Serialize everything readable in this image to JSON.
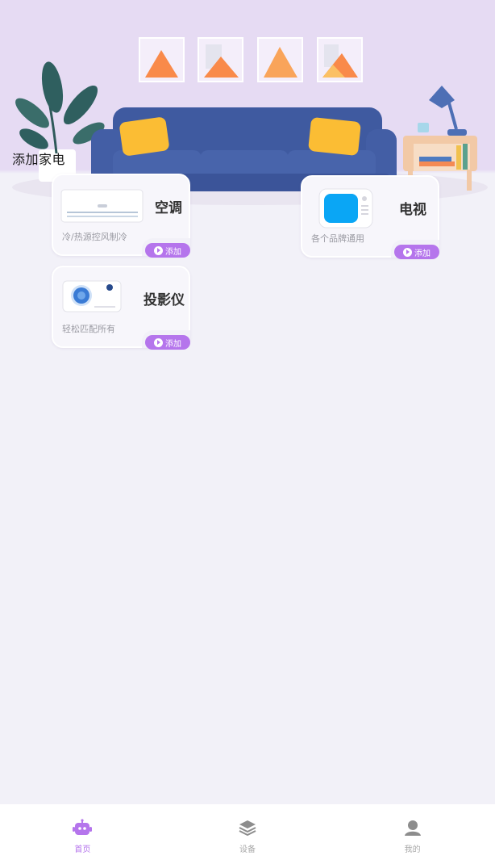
{
  "section_title": "添加家电",
  "devices": [
    {
      "name": "空调",
      "desc": "冷/热源控风制冷",
      "add_label": "添加",
      "icon": "air-conditioner-icon"
    },
    {
      "name": "电视",
      "desc": "各个品牌通用",
      "add_label": "添加",
      "icon": "tv-icon"
    },
    {
      "name": "投影仪",
      "desc": "轻松匹配所有",
      "add_label": "添加",
      "icon": "projector-icon"
    }
  ],
  "tabbar": [
    {
      "label": "首页",
      "icon": "robot-icon",
      "active": true
    },
    {
      "label": "设备",
      "icon": "layers-icon",
      "active": false
    },
    {
      "label": "我的",
      "icon": "user-icon",
      "active": false
    }
  ],
  "colors": {
    "accent": "#b575ec",
    "background": "#f2f1f8",
    "hero": "#e6dbf3"
  }
}
